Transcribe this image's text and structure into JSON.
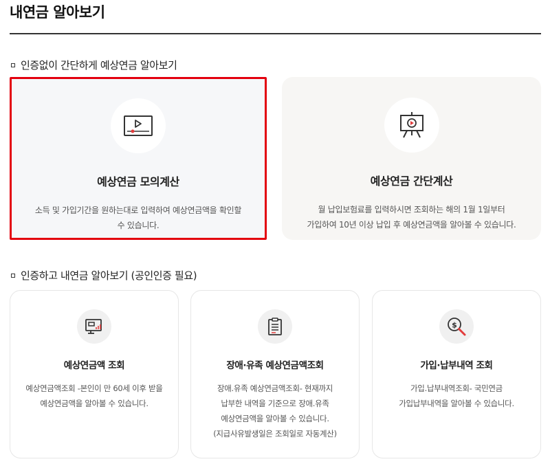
{
  "page": {
    "title": "내연금 알아보기"
  },
  "section1": {
    "heading": "인증없이 간단하게 예상연금 알아보기",
    "cards": [
      {
        "title": "예상연금 모의계산",
        "desc_lines": [
          "소득 및 가입기간을 원하는대로 입력하여 예상연금액을 확인할",
          "수 있습니다."
        ],
        "icon": "video-play-icon",
        "highlighted": true,
        "highlight_color": "#e3000e"
      },
      {
        "title": "예상연금 간단계산",
        "desc_lines": [
          "월 납입보험료를 입력하시면 조회하는 해의 1월 1일부터",
          "가입하여 10년 이상 납입 후 예상연금액을 알아볼 수 있습니다."
        ],
        "icon": "presentation-board-icon",
        "highlighted": false
      }
    ]
  },
  "section2": {
    "heading": "인증하고 내연금 알아보기 (공인인증 필요)",
    "cards": [
      {
        "title": "예상연금액 조회",
        "desc_lines": [
          "예상연금액조회 -본인이 만 60세 이후 받을",
          "예상연금액을 알아볼 수 있습니다."
        ],
        "icon": "monitor-chart-icon"
      },
      {
        "title": "장애·유족 예상연금액조회",
        "desc_lines": [
          "장애.유족 예상연금액조회- 현재까지",
          "납부한 내역을 기준으로 장애.유족",
          "예상연금액을 알아볼 수 있습니다.",
          "(지급사유발생일은 조회일로 자동계산)"
        ],
        "icon": "clipboard-icon"
      },
      {
        "title": "가입·납부내역 조회",
        "desc_lines": [
          "가입.납부내역조회- 국민연금",
          "가입납부내역을 알아볼 수 있습니다."
        ],
        "icon": "money-search-icon"
      }
    ]
  }
}
